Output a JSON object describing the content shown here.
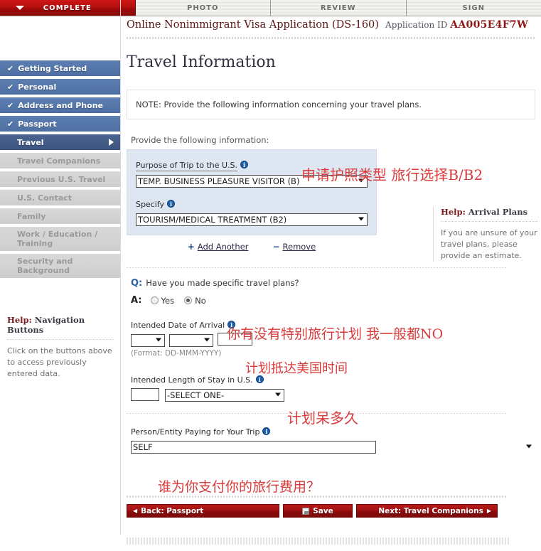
{
  "tabs": [
    {
      "label": "COMPLETE",
      "state": "active"
    },
    {
      "label": "PHOTO",
      "state": "inactive"
    },
    {
      "label": "REVIEW",
      "state": "inactive"
    },
    {
      "label": "SIGN",
      "state": "inactive"
    }
  ],
  "header": {
    "app_title": "Online Nonimmigrant Visa Application (DS-160)",
    "app_id_label": "Application ID",
    "app_id_value": "AA005E4F7W"
  },
  "sidebar": {
    "items": [
      {
        "label": "Getting Started",
        "state": "done",
        "check": "✔"
      },
      {
        "label": "Personal",
        "state": "done",
        "check": "✔"
      },
      {
        "label": "Address and Phone",
        "state": "done",
        "check": "✔"
      },
      {
        "label": "Passport",
        "state": "done",
        "check": "✔"
      },
      {
        "label": "Travel",
        "state": "active",
        "check": ""
      },
      {
        "label": "Travel Companions",
        "state": "disabled",
        "check": ""
      },
      {
        "label": "Previous U.S. Travel",
        "state": "disabled",
        "check": ""
      },
      {
        "label": "U.S. Contact",
        "state": "disabled",
        "check": ""
      },
      {
        "label": "Family",
        "state": "disabled",
        "check": ""
      },
      {
        "label": "Work / Education / Training",
        "state": "disabled",
        "check": ""
      },
      {
        "label": "Security and Background",
        "state": "disabled",
        "check": ""
      }
    ],
    "help": {
      "title_word": "Help:",
      "title_rest": " Navigation Buttons",
      "body": "Click on the buttons above to access previously entered data."
    }
  },
  "main": {
    "page_title": "Travel Information",
    "note": "NOTE: Provide the following information concerning your travel plans.",
    "provide_label": "Provide the following information:",
    "purpose": {
      "label": "Purpose of Trip to the U.S.",
      "value": "TEMP. BUSINESS PLEASURE VISITOR (B)"
    },
    "specify": {
      "label": "Specify",
      "value": "TOURISM/MEDICAL TREATMENT (B2)"
    },
    "add_another": "Add Another",
    "remove": "Remove",
    "add_sign": "+",
    "remove_sign": "−",
    "question": {
      "q_marker": "Q:",
      "q_text": "Have you made specific travel plans?",
      "a_marker": "A:",
      "option_yes": "Yes",
      "option_no": "No",
      "selected": "No"
    },
    "arrival": {
      "label": "Intended Date of Arrival",
      "day_value": "",
      "month_value": "",
      "year_value": "",
      "format_hint": "(Format: DD-MMM-YYYY)"
    },
    "stay": {
      "label": "Intended Length of Stay in U.S.",
      "number_value": "",
      "unit_value": "-SELECT ONE-"
    },
    "payer": {
      "label": "Person/Entity Paying for Your Trip",
      "value": "SELF"
    },
    "help": {
      "title_word": "Help:",
      "title_rest": " Arrival Plans",
      "body": "If you are unsure of your travel plans, please provide an estimate."
    },
    "buttons": {
      "back": "Back: Passport",
      "save": "Save",
      "next": "Next: Travel Companions",
      "back_arrow": "◀",
      "next_arrow": "▶"
    }
  },
  "annotations": [
    {
      "id": "cn1",
      "text": "申请护照类型  旅行选择B/B2"
    },
    {
      "id": "cn2",
      "text": "你有没有特别旅行计划  我一般都NO"
    },
    {
      "id": "cn3",
      "text": "计划抵达美国时间"
    },
    {
      "id": "cn4",
      "text": "计划呆多久"
    },
    {
      "id": "cn5",
      "text": "谁为你支付你的旅行费用？"
    }
  ],
  "colors": {
    "brand_red": "#a21212",
    "nav_blue": "#4e6fa3",
    "nav_active_blue": "#3d5680",
    "panel_blue": "#dde6f1",
    "annotation_red": "#d93a3a"
  }
}
